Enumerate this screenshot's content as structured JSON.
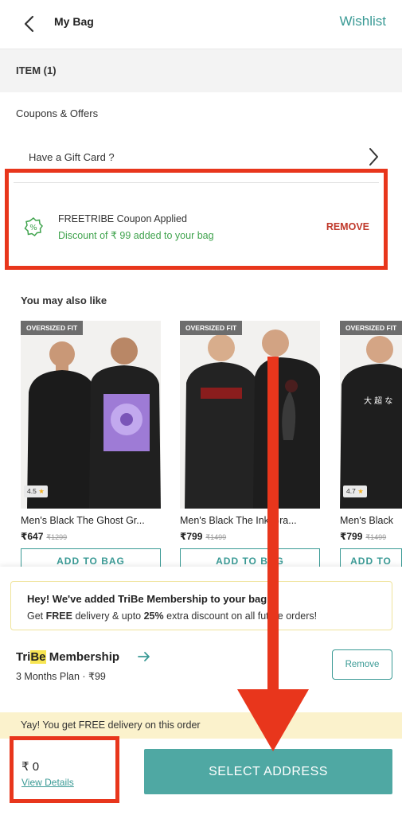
{
  "header": {
    "title": "My Bag",
    "wishlist_label": "Wishlist"
  },
  "items_section": {
    "label": "ITEM (1)"
  },
  "coupons": {
    "label": "Coupons & Offers",
    "gift_card_label": "Have a Gift Card ?",
    "applied_title": "FREETRIBE Coupon Applied",
    "applied_subtitle": "Discount of ₹ 99 added to your bag",
    "remove_label": "REMOVE"
  },
  "recommendations": {
    "title": "You may also like",
    "products": [
      {
        "badge": "OVERSIZED FIT",
        "rating": "4.5",
        "name": "Men's Black The Ghost Gr...",
        "price": "₹647",
        "mrp": "₹1299",
        "button": "ADD TO BAG"
      },
      {
        "badge": "OVERSIZED FIT",
        "rating": "",
        "name": "Men's Black The Ink Gra...",
        "price": "₹799",
        "mrp": "₹1499",
        "button": "ADD TO BAG"
      },
      {
        "badge": "OVERSIZED FIT",
        "rating": "4.7",
        "name": "Men's Black",
        "price": "₹799",
        "mrp": "₹1499",
        "button": "ADD TO BAG"
      }
    ]
  },
  "tribe": {
    "notice_title": "Hey! We've added TriBe Membership to your bag",
    "notice_sub_pre": "Get ",
    "notice_sub_free": "FREE",
    "notice_sub_mid": " delivery & upto ",
    "notice_sub_pct": "25%",
    "notice_sub_post": " extra discount on all future orders!",
    "title_pre": "Tri",
    "title_highlight": "Be",
    "title_post": " Membership",
    "plan": "3 Months Plan · ₹99",
    "remove_label": "Remove"
  },
  "delivery_banner": "Yay! You get FREE delivery on this order",
  "footer": {
    "total": "₹ 0",
    "view_details": "View Details",
    "select_address": "SELECT ADDRESS"
  },
  "colors": {
    "accent": "#3a9a95",
    "annotation_red": "#e8361c",
    "success_green": "#3fa34d",
    "remove_red": "#c0392b"
  }
}
